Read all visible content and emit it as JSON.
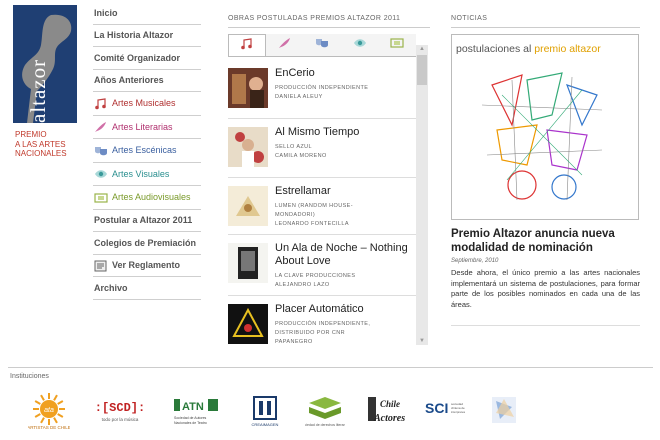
{
  "brand": {
    "logo_word": "altazor",
    "tagline": [
      "PREMIO",
      "A LAS ARTES",
      "NACIONALES"
    ],
    "navy": "#1f3f73",
    "red": "#c0392b"
  },
  "nav": [
    {
      "label": "Inicio",
      "type": "main"
    },
    {
      "label": "La Historia Altazor",
      "type": "main"
    },
    {
      "label": "Comité Organizador",
      "type": "main"
    },
    {
      "label": "Años Anteriores",
      "type": "main"
    },
    {
      "label": "Artes Musicales",
      "type": "sub",
      "icon": "music-note-icon",
      "color": "#b03030"
    },
    {
      "label": "Artes Literarias",
      "type": "sub",
      "icon": "quill-icon",
      "color": "#b0306e"
    },
    {
      "label": "Artes Escénicas",
      "type": "sub",
      "icon": "theater-masks-icon",
      "color": "#3a5f9f"
    },
    {
      "label": "Artes Visuales",
      "type": "sub",
      "icon": "eye-icon",
      "color": "#2a8f8f"
    },
    {
      "label": "Artes Audiovisuales",
      "type": "sub",
      "icon": "film-icon",
      "color": "#7a9a2a"
    },
    {
      "label": "Postular a Altazor 2011",
      "type": "main"
    },
    {
      "label": "Colegios de Premiación",
      "type": "main"
    },
    {
      "label": "Ver Reglamento",
      "type": "main",
      "icon": "document-icon"
    },
    {
      "label": "Archivo",
      "type": "main"
    }
  ],
  "works": {
    "title": "OBRAS POSTULADAS PREMIOS ALTAZOR 2011",
    "tabs": [
      "music-note-icon",
      "quill-icon",
      "theater-masks-icon",
      "eye-icon",
      "film-icon"
    ],
    "active_tab": 0,
    "items": [
      {
        "title": "EnCerio",
        "lines": [
          "PRODUCCIÓN INDEPENDIENTE",
          "DANIELA ALEUY"
        ]
      },
      {
        "title": "Al Mismo Tiempo",
        "lines": [
          "SELLO AZUL",
          "CAMILA MORENO"
        ]
      },
      {
        "title": "Estrellamar",
        "lines": [
          "LUMEN (RANDOM HOUSE-",
          "MONDADORI)",
          "LEONARDO FONTECILLA"
        ]
      },
      {
        "title": "Un Ala de Noche – Nothing About Love",
        "lines": [
          "LA CLAVE PRODUCCIONES",
          "ALEJANDRO LAZO"
        ]
      },
      {
        "title": "Placer Automático",
        "lines": [
          "PRODUCCIÓN INDEPENDIENTE,",
          "DISTRIBUIDO POR CNR",
          "PAPANEGRO"
        ]
      }
    ]
  },
  "news": {
    "title": "NOTICIAS",
    "image_text": "postulaciones al",
    "image_text_highlight": "premio altazor",
    "headline": "Premio Altazor anuncia nueva modalidad de nominación",
    "date": "Septiembre, 2010",
    "body": "Desde ahora, el único premio a las artes nacionales implementará un sistema de postulaciones, para formar parte de los posibles nominados en cada una de las áreas."
  },
  "footer": {
    "label": "Instituciones",
    "sponsors": [
      {
        "name": "ARTISTAS DE CHILE",
        "mark": "ata"
      },
      {
        "name": "todo por la música",
        "mark": ":[SCD]:"
      },
      {
        "name": "Sociedad de Autores Nacionales de Teatro, Cine y Audiovisuales",
        "mark": "ATN"
      },
      {
        "name": "CREAIMAGEN",
        "mark": ""
      },
      {
        "name": "sociedad de derechos literarios",
        "mark": ""
      },
      {
        "name": "Chile Actores",
        "mark": "Chile Actores"
      },
      {
        "name": "sociedad chilena de intérpretes",
        "mark": "SCI"
      },
      {
        "name": "",
        "mark": ""
      }
    ]
  }
}
